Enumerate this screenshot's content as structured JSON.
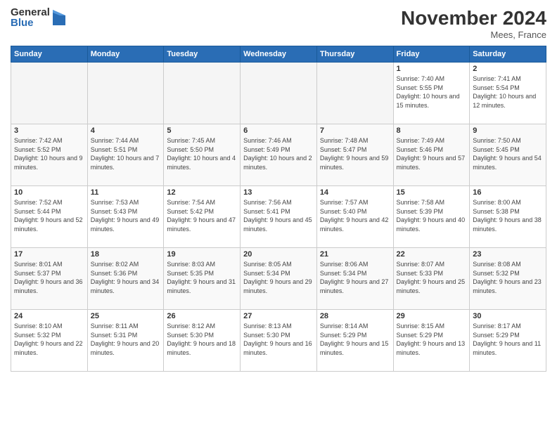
{
  "header": {
    "logo_general": "General",
    "logo_blue": "Blue",
    "month_title": "November 2024",
    "location": "Mees, France"
  },
  "weekdays": [
    "Sunday",
    "Monday",
    "Tuesday",
    "Wednesday",
    "Thursday",
    "Friday",
    "Saturday"
  ],
  "weeks": [
    [
      {
        "day": "",
        "sunrise": "",
        "sunset": "",
        "daylight": ""
      },
      {
        "day": "",
        "sunrise": "",
        "sunset": "",
        "daylight": ""
      },
      {
        "day": "",
        "sunrise": "",
        "sunset": "",
        "daylight": ""
      },
      {
        "day": "",
        "sunrise": "",
        "sunset": "",
        "daylight": ""
      },
      {
        "day": "",
        "sunrise": "",
        "sunset": "",
        "daylight": ""
      },
      {
        "day": "1",
        "sunrise": "Sunrise: 7:40 AM",
        "sunset": "Sunset: 5:55 PM",
        "daylight": "Daylight: 10 hours and 15 minutes."
      },
      {
        "day": "2",
        "sunrise": "Sunrise: 7:41 AM",
        "sunset": "Sunset: 5:54 PM",
        "daylight": "Daylight: 10 hours and 12 minutes."
      }
    ],
    [
      {
        "day": "3",
        "sunrise": "Sunrise: 7:42 AM",
        "sunset": "Sunset: 5:52 PM",
        "daylight": "Daylight: 10 hours and 9 minutes."
      },
      {
        "day": "4",
        "sunrise": "Sunrise: 7:44 AM",
        "sunset": "Sunset: 5:51 PM",
        "daylight": "Daylight: 10 hours and 7 minutes."
      },
      {
        "day": "5",
        "sunrise": "Sunrise: 7:45 AM",
        "sunset": "Sunset: 5:50 PM",
        "daylight": "Daylight: 10 hours and 4 minutes."
      },
      {
        "day": "6",
        "sunrise": "Sunrise: 7:46 AM",
        "sunset": "Sunset: 5:49 PM",
        "daylight": "Daylight: 10 hours and 2 minutes."
      },
      {
        "day": "7",
        "sunrise": "Sunrise: 7:48 AM",
        "sunset": "Sunset: 5:47 PM",
        "daylight": "Daylight: 9 hours and 59 minutes."
      },
      {
        "day": "8",
        "sunrise": "Sunrise: 7:49 AM",
        "sunset": "Sunset: 5:46 PM",
        "daylight": "Daylight: 9 hours and 57 minutes."
      },
      {
        "day": "9",
        "sunrise": "Sunrise: 7:50 AM",
        "sunset": "Sunset: 5:45 PM",
        "daylight": "Daylight: 9 hours and 54 minutes."
      }
    ],
    [
      {
        "day": "10",
        "sunrise": "Sunrise: 7:52 AM",
        "sunset": "Sunset: 5:44 PM",
        "daylight": "Daylight: 9 hours and 52 minutes."
      },
      {
        "day": "11",
        "sunrise": "Sunrise: 7:53 AM",
        "sunset": "Sunset: 5:43 PM",
        "daylight": "Daylight: 9 hours and 49 minutes."
      },
      {
        "day": "12",
        "sunrise": "Sunrise: 7:54 AM",
        "sunset": "Sunset: 5:42 PM",
        "daylight": "Daylight: 9 hours and 47 minutes."
      },
      {
        "day": "13",
        "sunrise": "Sunrise: 7:56 AM",
        "sunset": "Sunset: 5:41 PM",
        "daylight": "Daylight: 9 hours and 45 minutes."
      },
      {
        "day": "14",
        "sunrise": "Sunrise: 7:57 AM",
        "sunset": "Sunset: 5:40 PM",
        "daylight": "Daylight: 9 hours and 42 minutes."
      },
      {
        "day": "15",
        "sunrise": "Sunrise: 7:58 AM",
        "sunset": "Sunset: 5:39 PM",
        "daylight": "Daylight: 9 hours and 40 minutes."
      },
      {
        "day": "16",
        "sunrise": "Sunrise: 8:00 AM",
        "sunset": "Sunset: 5:38 PM",
        "daylight": "Daylight: 9 hours and 38 minutes."
      }
    ],
    [
      {
        "day": "17",
        "sunrise": "Sunrise: 8:01 AM",
        "sunset": "Sunset: 5:37 PM",
        "daylight": "Daylight: 9 hours and 36 minutes."
      },
      {
        "day": "18",
        "sunrise": "Sunrise: 8:02 AM",
        "sunset": "Sunset: 5:36 PM",
        "daylight": "Daylight: 9 hours and 34 minutes."
      },
      {
        "day": "19",
        "sunrise": "Sunrise: 8:03 AM",
        "sunset": "Sunset: 5:35 PM",
        "daylight": "Daylight: 9 hours and 31 minutes."
      },
      {
        "day": "20",
        "sunrise": "Sunrise: 8:05 AM",
        "sunset": "Sunset: 5:34 PM",
        "daylight": "Daylight: 9 hours and 29 minutes."
      },
      {
        "day": "21",
        "sunrise": "Sunrise: 8:06 AM",
        "sunset": "Sunset: 5:34 PM",
        "daylight": "Daylight: 9 hours and 27 minutes."
      },
      {
        "day": "22",
        "sunrise": "Sunrise: 8:07 AM",
        "sunset": "Sunset: 5:33 PM",
        "daylight": "Daylight: 9 hours and 25 minutes."
      },
      {
        "day": "23",
        "sunrise": "Sunrise: 8:08 AM",
        "sunset": "Sunset: 5:32 PM",
        "daylight": "Daylight: 9 hours and 23 minutes."
      }
    ],
    [
      {
        "day": "24",
        "sunrise": "Sunrise: 8:10 AM",
        "sunset": "Sunset: 5:32 PM",
        "daylight": "Daylight: 9 hours and 22 minutes."
      },
      {
        "day": "25",
        "sunrise": "Sunrise: 8:11 AM",
        "sunset": "Sunset: 5:31 PM",
        "daylight": "Daylight: 9 hours and 20 minutes."
      },
      {
        "day": "26",
        "sunrise": "Sunrise: 8:12 AM",
        "sunset": "Sunset: 5:30 PM",
        "daylight": "Daylight: 9 hours and 18 minutes."
      },
      {
        "day": "27",
        "sunrise": "Sunrise: 8:13 AM",
        "sunset": "Sunset: 5:30 PM",
        "daylight": "Daylight: 9 hours and 16 minutes."
      },
      {
        "day": "28",
        "sunrise": "Sunrise: 8:14 AM",
        "sunset": "Sunset: 5:29 PM",
        "daylight": "Daylight: 9 hours and 15 minutes."
      },
      {
        "day": "29",
        "sunrise": "Sunrise: 8:15 AM",
        "sunset": "Sunset: 5:29 PM",
        "daylight": "Daylight: 9 hours and 13 minutes."
      },
      {
        "day": "30",
        "sunrise": "Sunrise: 8:17 AM",
        "sunset": "Sunset: 5:29 PM",
        "daylight": "Daylight: 9 hours and 11 minutes."
      }
    ]
  ]
}
